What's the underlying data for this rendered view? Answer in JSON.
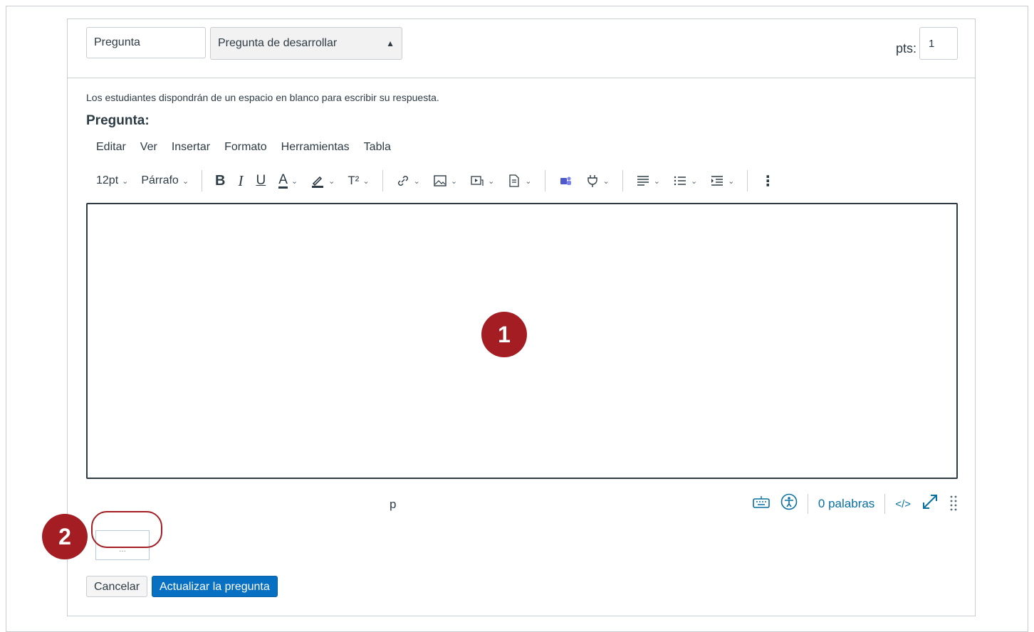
{
  "header": {
    "question_name": "Pregunta",
    "question_type": "Pregunta de desarrollar",
    "points_label": "pts:",
    "points_value": "1"
  },
  "help_text": "Los estudiantes dispondrán de un espacio en blanco para escribir su respuesta.",
  "question_label": "Pregunta:",
  "menubar": [
    "Editar",
    "Ver",
    "Insertar",
    "Formato",
    "Herramientas",
    "Tabla"
  ],
  "toolbar": {
    "font_size": "12pt",
    "block_format": "Párrafo",
    "bold": "B",
    "italic": "I",
    "underline": "U",
    "text_color": "A",
    "superscript": "T²",
    "more": "⋮"
  },
  "statusbar": {
    "path": "p",
    "word_count": "0 palabras",
    "html_toggle": "</>"
  },
  "callouts": {
    "badge_1": "1",
    "badge_2": "2",
    "placeholder": "..."
  },
  "buttons": {
    "cancel": "Cancelar",
    "update": "Actualizar la pregunta"
  },
  "colors": {
    "accent_red": "#a31d23",
    "link_blue": "#0770a3",
    "primary_button": "#0770c3"
  }
}
